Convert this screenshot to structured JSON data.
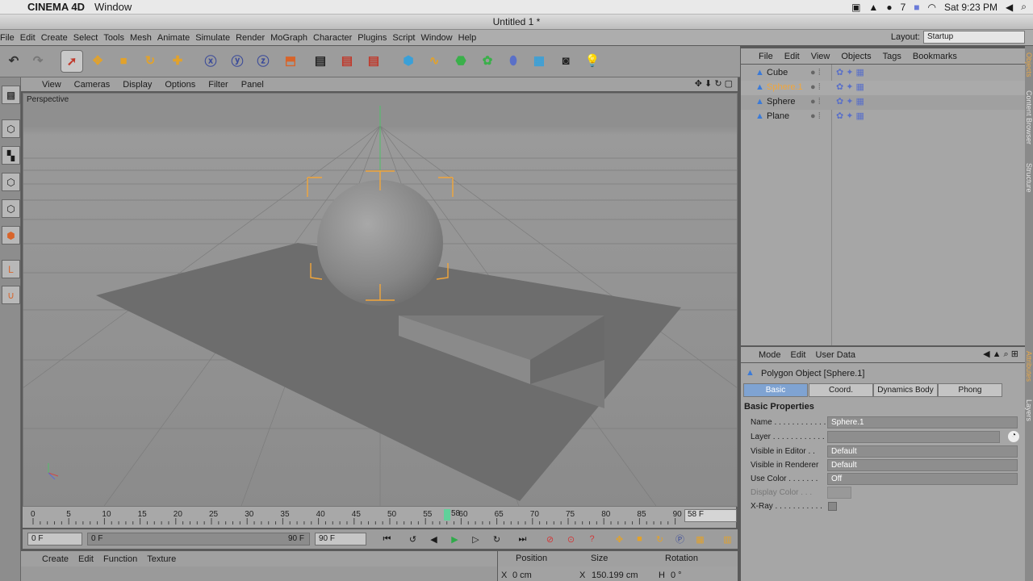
{
  "mac_menubar": {
    "app_name": "CINEMA 4D",
    "menu": "Window",
    "badge": "7",
    "clock": "Sat 9:23 PM"
  },
  "window_title": "Untitled 1 *",
  "main_menu": [
    "File",
    "Edit",
    "Create",
    "Select",
    "Tools",
    "Mesh",
    "Animate",
    "Simulate",
    "Render",
    "MoGraph",
    "Character",
    "Plugins",
    "Script",
    "Window",
    "Help"
  ],
  "layout": {
    "label": "Layout:",
    "value": "Startup"
  },
  "viewport": {
    "menu": [
      "View",
      "Cameras",
      "Display",
      "Options",
      "Filter",
      "Panel"
    ],
    "camera_label": "Perspective"
  },
  "timeline": {
    "ticks": [
      "0",
      "5",
      "10",
      "15",
      "20",
      "25",
      "30",
      "35",
      "40",
      "45",
      "50",
      "55",
      "60",
      "65",
      "70",
      "75",
      "80",
      "85",
      "90"
    ],
    "current_frame_marker": "58",
    "current_frame_field": "58 F",
    "start_field": "0 F",
    "range_start": "0 F",
    "range_end": "90 F",
    "end_field": "90 F"
  },
  "material_menu": [
    "Create",
    "Edit",
    "Function",
    "Texture"
  ],
  "coordinates": {
    "headers": [
      "Position",
      "Size",
      "Rotation"
    ],
    "row1": {
      "pos_axis": "X",
      "pos_value": "0 cm",
      "size_axis": "X",
      "size_value": "150.199 cm",
      "rot_axis": "H",
      "rot_value": "0 °"
    }
  },
  "object_manager": {
    "menu": [
      "File",
      "Edit",
      "View",
      "Objects",
      "Tags",
      "Bookmarks"
    ],
    "objects": [
      {
        "name": "Cube",
        "selected": false
      },
      {
        "name": "Sphere.1",
        "selected": true
      },
      {
        "name": "Sphere",
        "selected": false
      },
      {
        "name": "Plane",
        "selected": false
      }
    ]
  },
  "attributes": {
    "menu": [
      "Mode",
      "Edit",
      "User Data"
    ],
    "title": "Polygon Object [Sphere.1]",
    "tabs": [
      "Basic",
      "Coord.",
      "Dynamics Body",
      "Phong"
    ],
    "active_tab": "Basic",
    "section": "Basic Properties",
    "props": [
      {
        "label": "Name . . . . . . . . . . . .",
        "value": "Sphere.1"
      },
      {
        "label": "Layer . . . . . . . . . . . .",
        "value": ""
      },
      {
        "label": "Visible in Editor . .",
        "value": "Default"
      },
      {
        "label": "Visible in Renderer",
        "value": "Default"
      },
      {
        "label": "Use Color . . . . . . .",
        "value": "Off"
      },
      {
        "label": "Display Color . . .",
        "value": ""
      },
      {
        "label": "X-Ray . . . . . . . . . . .",
        "value": ""
      }
    ]
  },
  "side_tabs": [
    "Objects",
    "Content Browser",
    "Structure",
    "Attributes",
    "Layers"
  ],
  "colors": {
    "selection_orange": "#f2a63a",
    "active_tab": "#7fa3d2",
    "frame_marker": "#5fd19a"
  }
}
